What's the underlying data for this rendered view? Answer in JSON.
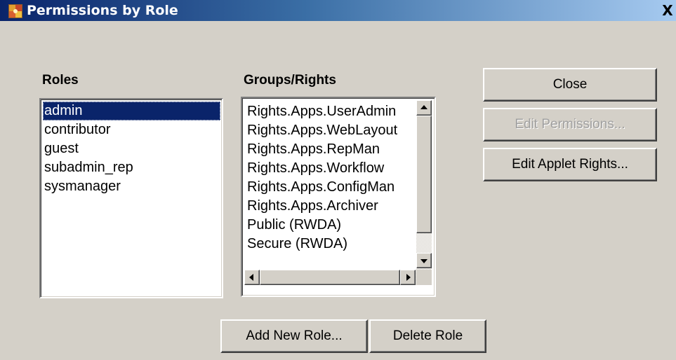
{
  "window": {
    "title": "Permissions by Role",
    "app_icon": "puzzle-app-icon",
    "close_glyph": "X"
  },
  "roles": {
    "label": "Roles",
    "items": [
      "admin",
      "contributor",
      "guest",
      "subadmin_rep",
      "sysmanager"
    ],
    "selected": "admin"
  },
  "rights": {
    "label": "Groups/Rights",
    "items": [
      "Rights.Apps.UserAdmin",
      "Rights.Apps.WebLayout",
      "Rights.Apps.RepMan",
      "Rights.Apps.Workflow",
      "Rights.Apps.ConfigMan",
      "Rights.Apps.Archiver",
      "Public  (RWDA)",
      "Secure  (RWDA)"
    ]
  },
  "buttons": {
    "close": "Close",
    "edit_permissions": "Edit Permissions...",
    "edit_applet_rights": "Edit Applet Rights...",
    "add_new_role": "Add New Role...",
    "delete_role": "Delete Role"
  },
  "colors": {
    "face": "#d4d0c8",
    "selection": "#0a246a",
    "titlebar_start": "#0a246a",
    "titlebar_end": "#a6caf0",
    "disabled_text": "#a0a0a0"
  }
}
